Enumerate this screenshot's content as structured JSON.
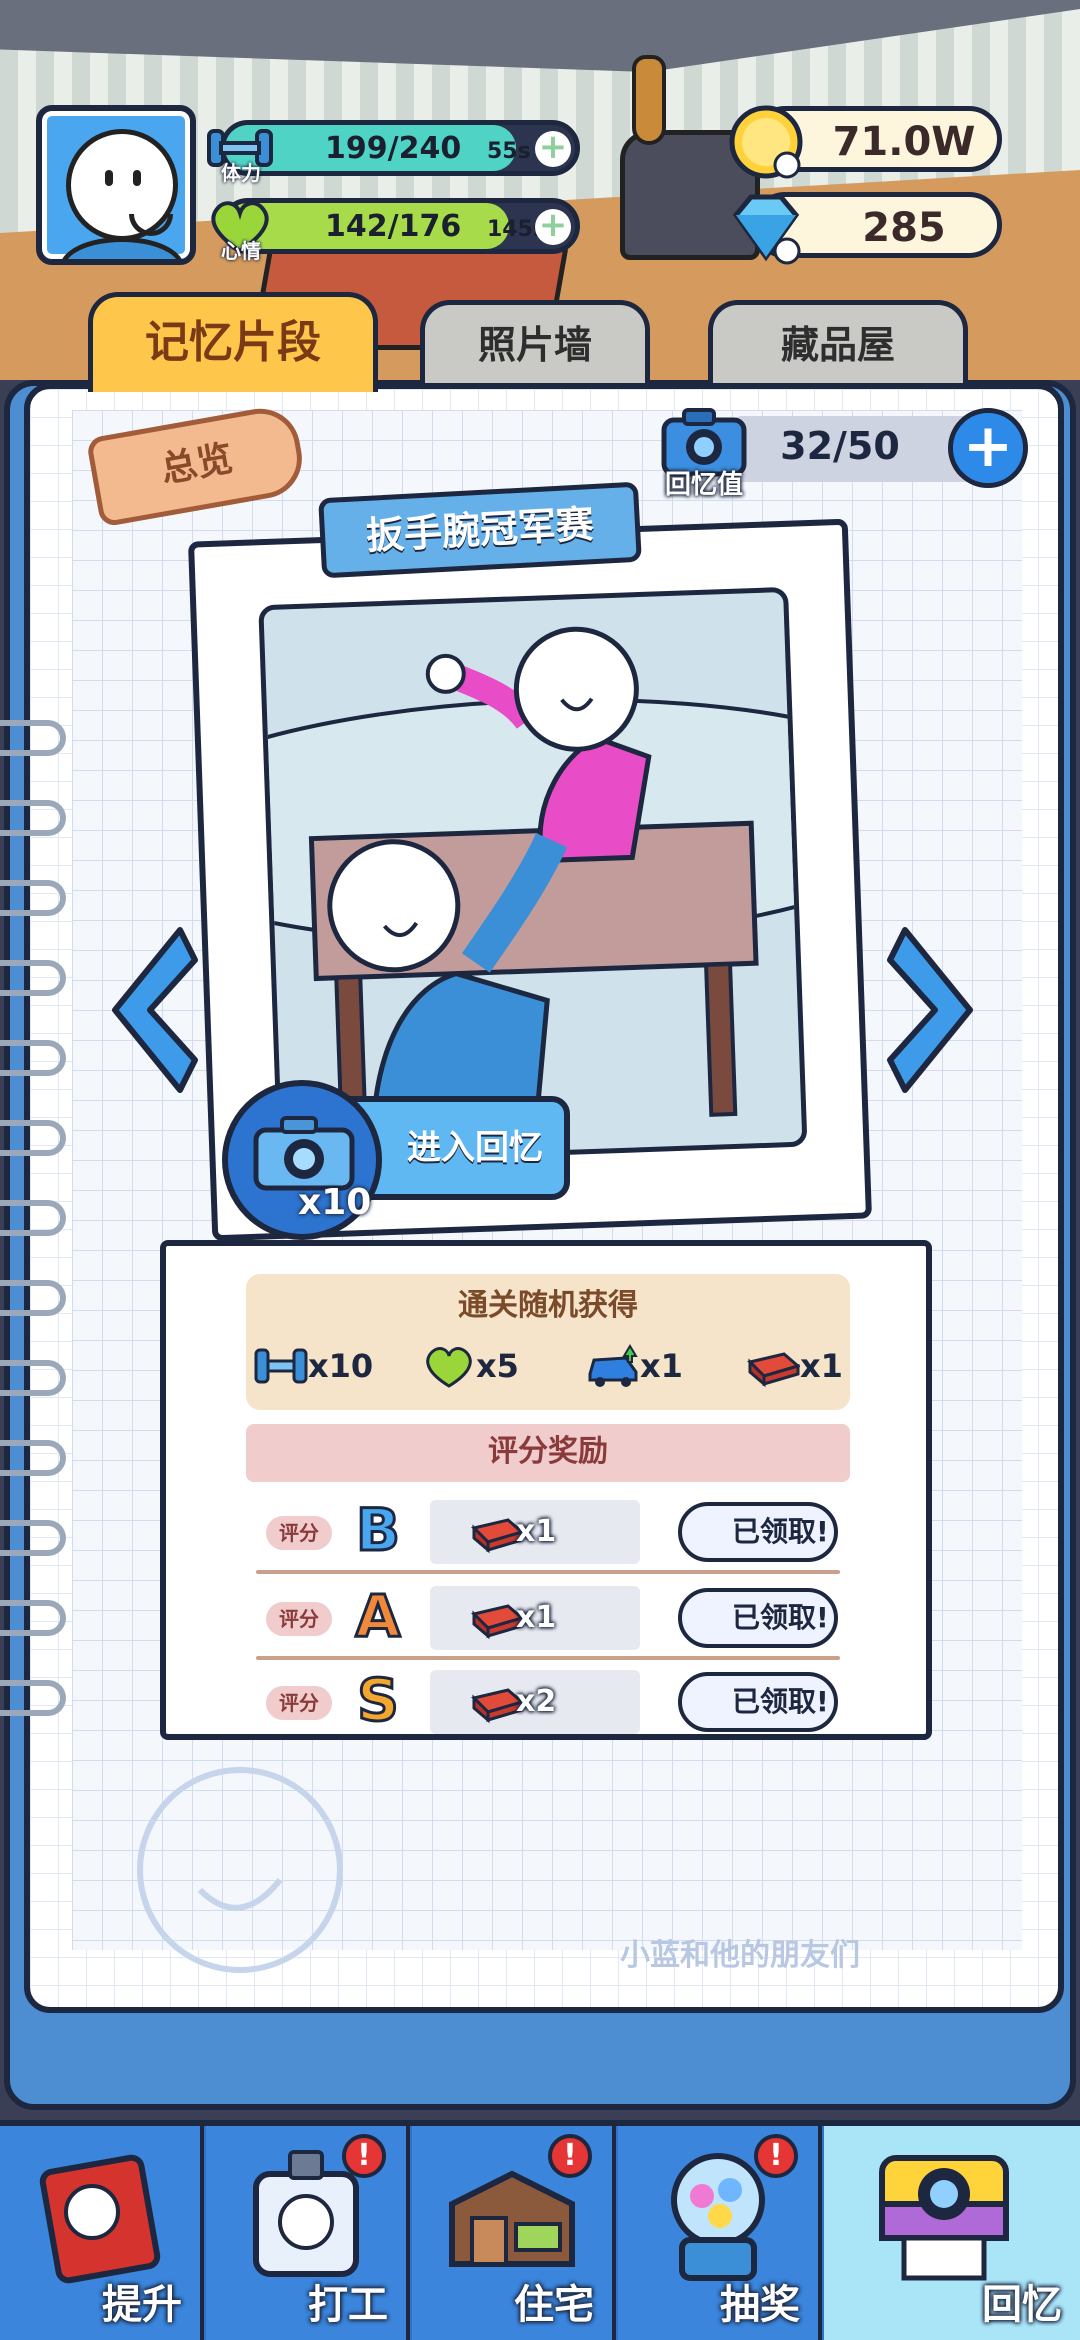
{
  "hud": {
    "stamina": {
      "label": "体力",
      "value": "199/240",
      "timer": "55s",
      "fill_ratio": 0.83,
      "color": "#4fd3c4"
    },
    "mood": {
      "label": "心情",
      "value": "142/176",
      "timer": "145s",
      "fill_ratio": 0.81,
      "color": "#a7db4a"
    },
    "coins": {
      "value": "71.0W",
      "icon": "gold-coin-icon"
    },
    "diamonds": {
      "value": "285",
      "icon": "diamond-icon"
    }
  },
  "tabs": [
    {
      "label": "记忆片段",
      "active": true
    },
    {
      "label": "照片墙",
      "active": false
    },
    {
      "label": "藏品屋",
      "active": false
    }
  ],
  "notebook": {
    "overview_label": "总览",
    "camera_label": "回忆值",
    "memory_counter": "32/50",
    "photo_title": "扳手腕冠军赛",
    "enter_button": "进入回忆",
    "enter_cost": "x10"
  },
  "rewards": {
    "random_title": "通关随机获得",
    "random_items": [
      {
        "icon": "dumbbell-icon",
        "qty": "x10"
      },
      {
        "icon": "heart-icon",
        "qty": "x5"
      },
      {
        "icon": "car-upgrade-icon",
        "qty": "x1"
      },
      {
        "icon": "red-brick-icon",
        "qty": "x1"
      }
    ],
    "score_title": "评分奖励",
    "score_chip": "评分",
    "score_rows": [
      {
        "grade": "B",
        "grade_color": "#49a7f0",
        "qty": "x1",
        "status": "已领取!"
      },
      {
        "grade": "A",
        "grade_color": "#f08a3a",
        "qty": "x1",
        "status": "已领取!"
      },
      {
        "grade": "S",
        "grade_color": "#f4a72e",
        "qty": "x2",
        "status": "已领取!"
      }
    ]
  },
  "watermark": "小蓝和他的朋友们",
  "bottom_nav": [
    {
      "label": "提升",
      "badge": "",
      "active": false
    },
    {
      "label": "打工",
      "badge": "!",
      "active": false
    },
    {
      "label": "住宅",
      "badge": "!",
      "active": false
    },
    {
      "label": "抽奖",
      "badge": "!",
      "active": false
    },
    {
      "label": "回忆",
      "badge": "",
      "active": true
    }
  ],
  "colors": {
    "accent_blue": "#2e8ae8",
    "tab_active": "#ffc64c",
    "outline": "#1d2740"
  }
}
